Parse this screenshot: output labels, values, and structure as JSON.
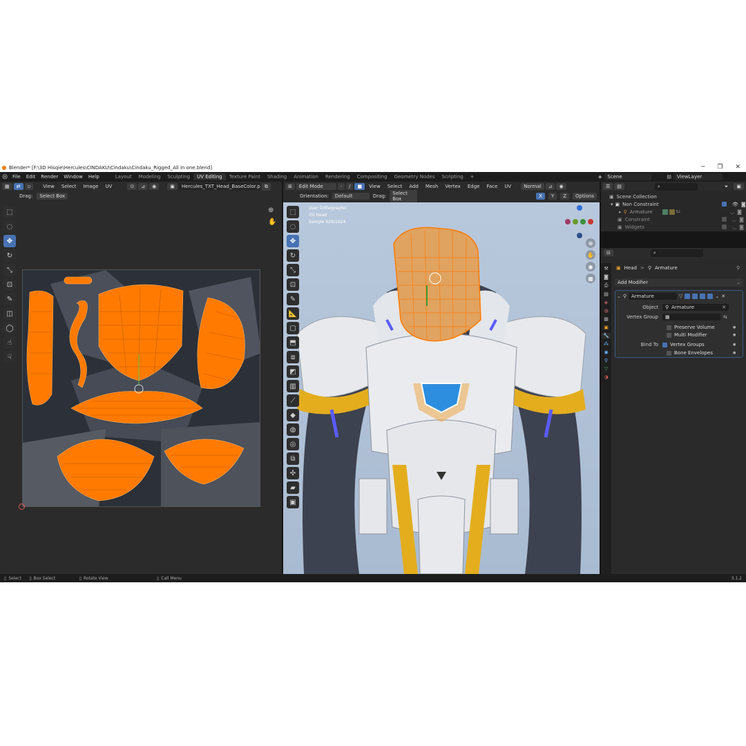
{
  "window": {
    "title": "Blender* [F:\\3D Hisqie\\Hercules\\CINDAKU\\Cindaku\\Cindaku_Rigged_All in one.blend]",
    "minimize": "─",
    "maximize": "❐",
    "close": "✕"
  },
  "menu": [
    "File",
    "Edit",
    "Render",
    "Window",
    "Help"
  ],
  "workspaces": [
    "Layout",
    "Modeling",
    "Sculpting",
    "UV Editing",
    "Texture Paint",
    "Shading",
    "Animation",
    "Rendering",
    "Compositing",
    "Geometry Nodes",
    "Scripting"
  ],
  "active_workspace": "UV Editing",
  "add_workspace": "+",
  "scene": {
    "name": "Scene",
    "view_layer": "ViewLayer"
  },
  "uv_editor": {
    "menus": [
      "View",
      "Select",
      "Image",
      "UV"
    ],
    "image_name": "Hercules_TXT_Head_BaseColor.png",
    "drag_label": "Drag:",
    "drag_value": "Select Box"
  },
  "viewport": {
    "mode": "Edit Mode",
    "menus": [
      "View",
      "Select",
      "Add",
      "Mesh",
      "Vertex",
      "Edge",
      "Face",
      "UV"
    ],
    "shading": "Normal",
    "orientation_label": "Orientation:",
    "orientation_value": "Default",
    "drag_label": "Drag:",
    "drag_value": "Select Box",
    "options": "Options",
    "axes": [
      "X",
      "Y",
      "Z"
    ],
    "overlay_lines": [
      "User Orthographic",
      "(0) Head",
      "Sample 629/1024"
    ]
  },
  "outliner": {
    "root": "Scene Collection",
    "items": [
      {
        "name": "Non Constraint",
        "level": 1
      },
      {
        "name": "Armature",
        "level": 2,
        "badge": "52"
      },
      {
        "name": "Constraint",
        "level": 1
      },
      {
        "name": "Widgets",
        "level": 1
      }
    ]
  },
  "properties": {
    "breadcrumb_object": "Head",
    "breadcrumb_sep": ">",
    "breadcrumb_modifier": "Armature",
    "add_modifier": "Add Modifier",
    "modifier_name": "Armature",
    "object_label": "Object",
    "object_value": "Armature",
    "vertex_group_label": "Vertex Group",
    "preserve_volume": "Preserve Volume",
    "multi_modifier": "Multi Modifier",
    "bind_to_label": "Bind To",
    "vertex_groups": "Vertex Groups",
    "bone_envelopes": "Bone Envelopes"
  },
  "statusbar": {
    "items": [
      "Select",
      "Box Select",
      "Rotate View",
      "Call Menu"
    ],
    "version": "3.1.2"
  },
  "colors": {
    "accent": "#4772b3",
    "uv_orange": "#ff7a00",
    "viewport_bg": "#aec0d6",
    "app_bg": "#303030"
  }
}
